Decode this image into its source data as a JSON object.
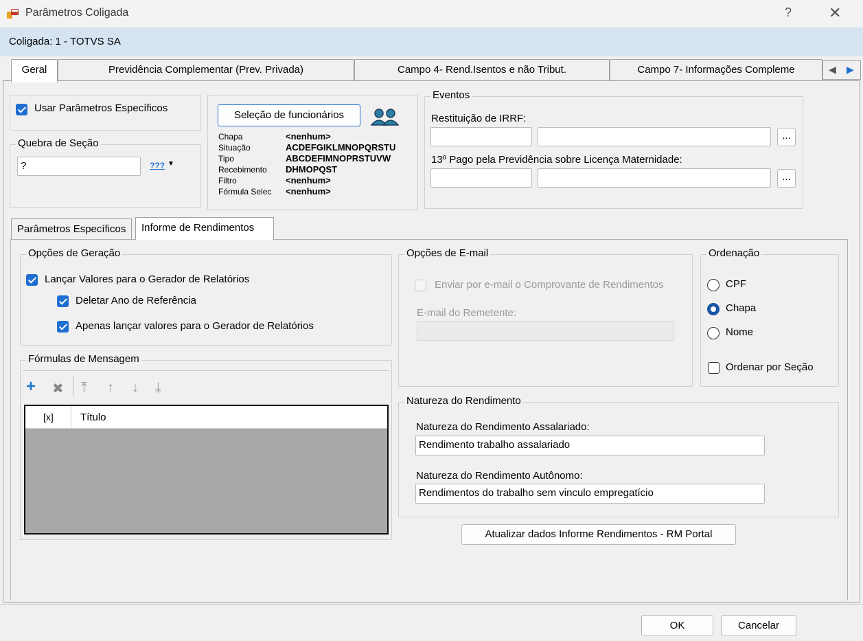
{
  "window": {
    "title": "Parâmetros Coligada",
    "help_glyph": "?",
    "close_glyph": "✕"
  },
  "coligada": "Coligada: 1 - TOTVS SA",
  "tabs": [
    {
      "label": "Geral",
      "active": true
    },
    {
      "label": "Previdência Complementar (Prev. Privada)",
      "active": false
    },
    {
      "label": "Campo 4- Rend.Isentos e não Tribut.",
      "active": false
    },
    {
      "label": "Campo 7- Informações Compleme",
      "active": false
    }
  ],
  "geral": {
    "usar_parametros": "Usar Parâmetros Específicos",
    "quebra_secao": {
      "legend": "Quebra de Seção",
      "value": "?",
      "button": "???"
    },
    "selecao": {
      "button": "Seleção de funcionários",
      "rows": [
        {
          "label": "Chapa",
          "value": "<nenhum>"
        },
        {
          "label": "Situação",
          "value": "ACDEFGIKLMNOPQRSTU"
        },
        {
          "label": "Tipo",
          "value": "ABCDEFIMNOPRSTUVW"
        },
        {
          "label": "Recebimento",
          "value": "DHMOPQST"
        },
        {
          "label": "Filtro",
          "value": "<nenhum>"
        },
        {
          "label": "Fórmula Selec",
          "value": "<nenhum>"
        }
      ]
    },
    "eventos": {
      "legend": "Eventos",
      "restituicao": "Restituição de IRRF:",
      "decimo": "13º Pago pela Previdência sobre Licença Maternidade:",
      "ellipsis": "..."
    }
  },
  "subtabs": [
    {
      "label": "Parâmetros Específicos",
      "active": false
    },
    {
      "label": "Informe de Rendimentos",
      "active": true
    }
  ],
  "opcoes_geracao": {
    "legend": "Opções de Geração",
    "lancar": "Lançar Valores para o Gerador de Relatórios",
    "deletar": "Deletar Ano de Referência",
    "apenas": "Apenas lançar valores para o Gerador de Relatórios"
  },
  "formulas": {
    "legend": "Fórmulas de Mensagem",
    "columns": [
      "[x]",
      "Título"
    ]
  },
  "email": {
    "legend": "Opções de E-mail",
    "enviar": "Enviar por e-mail o Comprovante de Rendimentos",
    "remetente_label": "E-mail do Remetente:",
    "remetente_value": ""
  },
  "ordenacao": {
    "legend": "Ordenação",
    "options": [
      "CPF",
      "Chapa",
      "Nome"
    ],
    "selected": "Chapa",
    "ordenar_secao": "Ordenar por Seção"
  },
  "natureza": {
    "legend": "Natureza do Rendimento",
    "assalariado_label": "Natureza do Rendimento Assalariado:",
    "assalariado_value": "Rendimento trabalho assalariado",
    "autonomo_label": "Natureza do Rendimento Autônomo:",
    "autonomo_value": "Rendimentos do trabalho sem vinculo empregatício"
  },
  "atualizar_button": "Atualizar dados Informe Rendimentos - RM Portal",
  "footer": {
    "ok": "OK",
    "cancel": "Cancelar"
  },
  "colors": {
    "accent": "#1f6fd0",
    "band": "#d6e4f2"
  }
}
